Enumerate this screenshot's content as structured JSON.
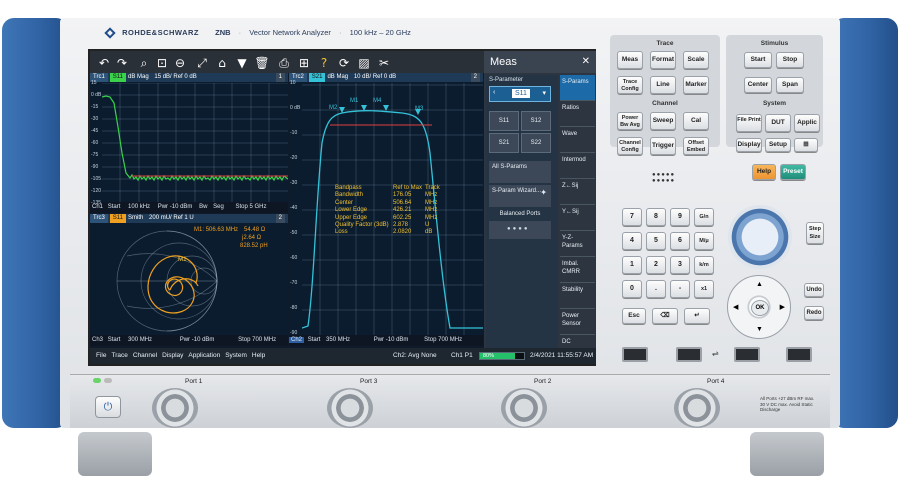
{
  "header": {
    "brand": "ROHDE&SCHWARZ",
    "model": "ZNB",
    "description": "Vector Network Analyzer",
    "range": "100 kHz – 20 GHz"
  },
  "trace_windows": [
    {
      "trace": "Trc1",
      "param": "S11",
      "format": "dB Mag",
      "scale": "15 dB/ Ref 0 dB",
      "selector": "1",
      "y_ticks": [
        "15",
        "0 dB",
        "-15",
        "-30",
        "-45",
        "-60",
        "-75",
        "-90",
        "-105",
        "-120",
        "-135"
      ],
      "footer": {
        "channel": "Ch1",
        "start": "Start",
        "start_value": "100 kHz",
        "pwr": "Pwr",
        "pwr_value": "-10 dBm",
        "bw": "Bw",
        "seg": "Seg",
        "stop": "Stop",
        "stop_value": "5 GHz"
      }
    },
    {
      "trace": "Trc2",
      "param": "S21",
      "format": "dB Mag",
      "scale": "10 dB/ Ref 0 dB",
      "selector": "2",
      "y_ticks": [
        "10",
        "0 dB",
        "-10",
        "-20",
        "-30",
        "-40",
        "-50",
        "-60",
        "-70",
        "-80",
        "-90"
      ],
      "markers": [
        "M1",
        "M2",
        "M3",
        "M4"
      ],
      "bandfilter": [
        {
          "label": "Bandpass",
          "value": "Ref to Max",
          "unit": "Track"
        },
        {
          "label": "Bandwidth",
          "value": "176.05",
          "unit": "MHz"
        },
        {
          "label": "Center",
          "value": "506.64",
          "unit": "MHz"
        },
        {
          "label": "Lower Edge",
          "value": "426.21",
          "unit": "MHz"
        },
        {
          "label": "Upper Edge",
          "value": "602.25",
          "unit": "MHz"
        },
        {
          "label": "Quality Factor (3dB)",
          "value": "2.878",
          "unit": "U"
        },
        {
          "label": "Loss",
          "value": "2.0820",
          "unit": "dB"
        }
      ],
      "footer": {
        "channel": "Ch2",
        "start": "Start",
        "start_value": "350 MHz",
        "pwr": "Pwr",
        "pwr_value": "-10 dBm",
        "stop": "Stop",
        "stop_value": "700 MHz"
      }
    },
    {
      "trace": "Trc3",
      "param": "S11",
      "format": "Smith",
      "scale": "200 mU/ Ref 1 U",
      "selector": "2",
      "marker_readout": {
        "label": "M1",
        "freq": "506.63 MHz",
        "r": "54.48 Ω",
        "x": "j2.64 Ω",
        "l": "828.52 pH"
      },
      "marker": "M1",
      "footer": {
        "channel": "Ch3",
        "start": "Start",
        "start_value": "300 MHz",
        "pwr": "Pwr",
        "pwr_value": "-10 dBm",
        "stop": "Stop",
        "stop_value": "700 MHz"
      }
    }
  ],
  "menubar": {
    "items": [
      "File",
      "Trace",
      "Channel",
      "Display",
      "Application",
      "System",
      "Help"
    ],
    "avg": "Ch2: Avg None",
    "port": "Ch1 P1",
    "progress_percent": 80,
    "progress_label": "80%",
    "datetime": "2/4/2021 11:55:57 AM"
  },
  "meas_panel": {
    "title": "Meas",
    "close": "✕",
    "sparam_label": "S-Parameter",
    "sparam_value": "S11",
    "sparams": [
      "S11",
      "S12",
      "S21",
      "S22"
    ],
    "all_sparams": "All S-Params",
    "wizard": "S-Param Wizard...",
    "balanced": "Balanced Ports",
    "softkeys": [
      "S-Params",
      "Ratios",
      "Wave",
      "Intermod",
      "Z←Sij",
      "Y←Sij",
      "Y-Z-Params",
      "Imbal. CMRR",
      "Stability",
      "Power Sensor",
      "DC"
    ]
  },
  "keys": {
    "trace_group": "Trace",
    "trace": [
      "Meas",
      "Format",
      "Scale",
      "Trace Config",
      "Line",
      "Marker"
    ],
    "channel_group": "Channel",
    "channel": [
      "Power Bw Avg",
      "Sweep",
      "Cal",
      "Channel Config",
      "Trigger",
      "Offset Embed"
    ],
    "stimulus_group": "Stimulus",
    "stimulus": [
      "Start",
      "Stop",
      "Center",
      "Span"
    ],
    "system_group": "System",
    "system": [
      "File Print",
      "DUT",
      "Applic",
      "Display",
      "Setup"
    ],
    "help": "Help",
    "preset": "Preset",
    "numpad": [
      "7",
      "8",
      "9",
      "G/n",
      "4",
      "5",
      "6",
      "M/μ",
      "1",
      "2",
      "3",
      "k/m",
      "0",
      ".",
      "-",
      "x1"
    ],
    "esc": "Esc",
    "step": "Step Size",
    "undo": "Undo",
    "redo": "Redo",
    "ok": "OK"
  },
  "ports": [
    "Port 1",
    "Port 3",
    "Port 2",
    "Port 4"
  ],
  "warning": "All Ports +27 dBm RF max. 30 V DC max. Avoid Static Discharge",
  "power_icon": "power-icon",
  "colors": {
    "accent": "#3567aa",
    "trace_yellow": "#f2c230",
    "trace_green": "#39d24a",
    "trace_cyan": "#34c2d8",
    "smith_orange": "#f0a020",
    "preset_teal": "#2aa08c",
    "help_orange": "#f2a443"
  }
}
